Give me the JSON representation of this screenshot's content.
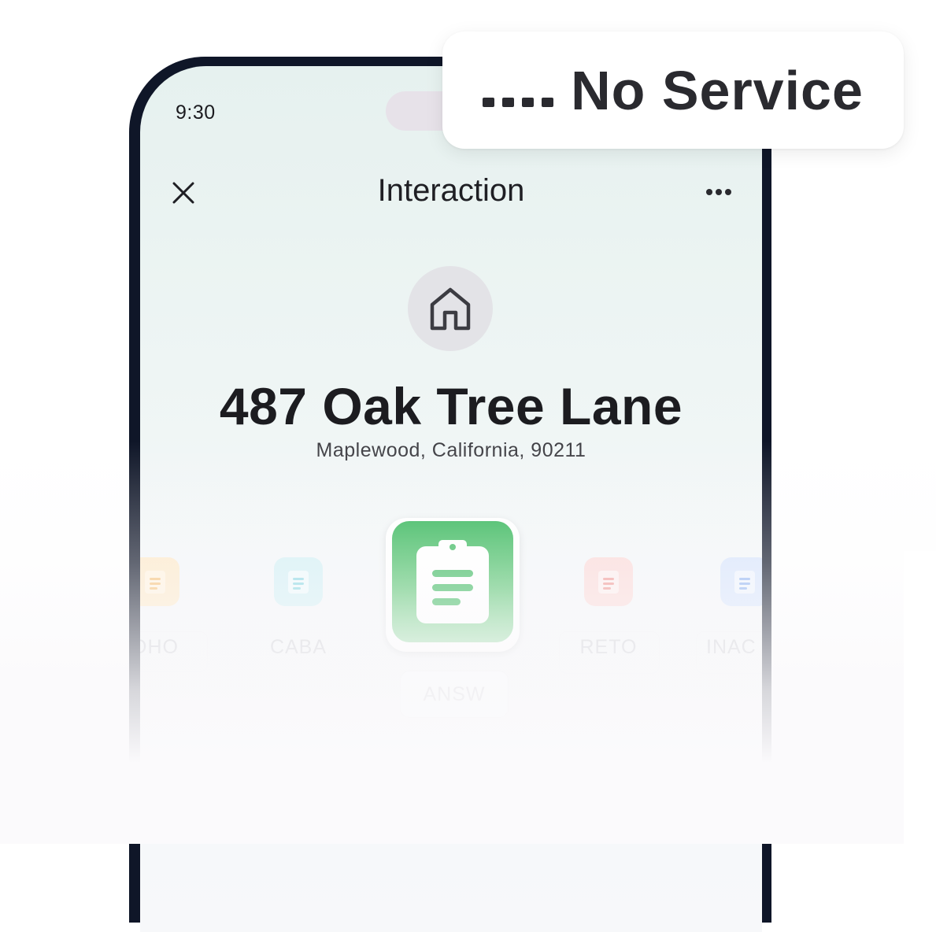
{
  "status_bar": {
    "time": "9:30"
  },
  "toast": {
    "text": "No Service",
    "signal_icon": "signal-dots-icon"
  },
  "nav": {
    "title": "Interaction",
    "close_icon": "close-icon",
    "more_icon": "more-horizontal-icon"
  },
  "location": {
    "icon": "home-icon",
    "address": "487 Oak Tree Lane",
    "city_line": "Maplewood, California, 90211"
  },
  "options": [
    {
      "label": "OHO",
      "color": "#f5a623"
    },
    {
      "label": "CABA",
      "color": "#3fc4d6"
    },
    {
      "label": "ANSW",
      "color": "#34b35a",
      "selected": true
    },
    {
      "label": "RETO",
      "color": "#e85a5a"
    },
    {
      "label": "INAC",
      "color": "#3b7be8"
    }
  ],
  "colors": {
    "phone_frame": "#0f1628",
    "selected_green": "#34b35a",
    "text_primary": "#1c1c20"
  }
}
